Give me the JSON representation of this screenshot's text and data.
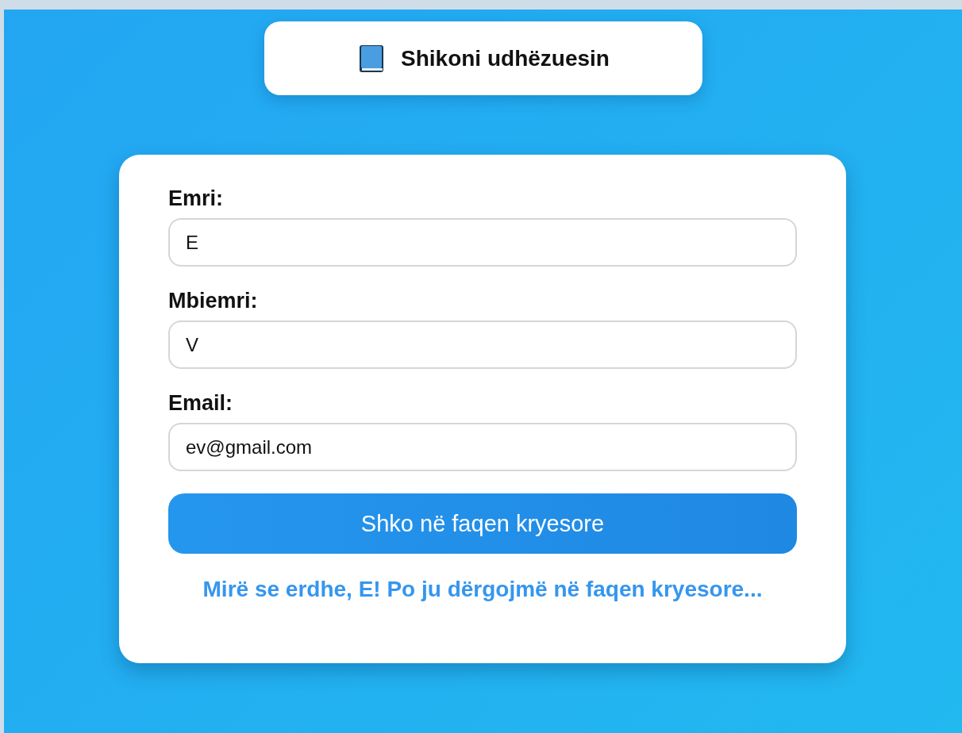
{
  "guide_button": {
    "label": "Shikoni udhëzuesin"
  },
  "form": {
    "fields": [
      {
        "label": "Emri:",
        "value": "E"
      },
      {
        "label": "Mbiemri:",
        "value": "V"
      },
      {
        "label": "Email:",
        "value": "ev@gmail.com"
      }
    ],
    "submit_button": {
      "label": "Shko në faqen kryesore"
    },
    "message": "Mirë se erdhe, E! Po ju dërgojmë në faqen kryesore..."
  }
}
